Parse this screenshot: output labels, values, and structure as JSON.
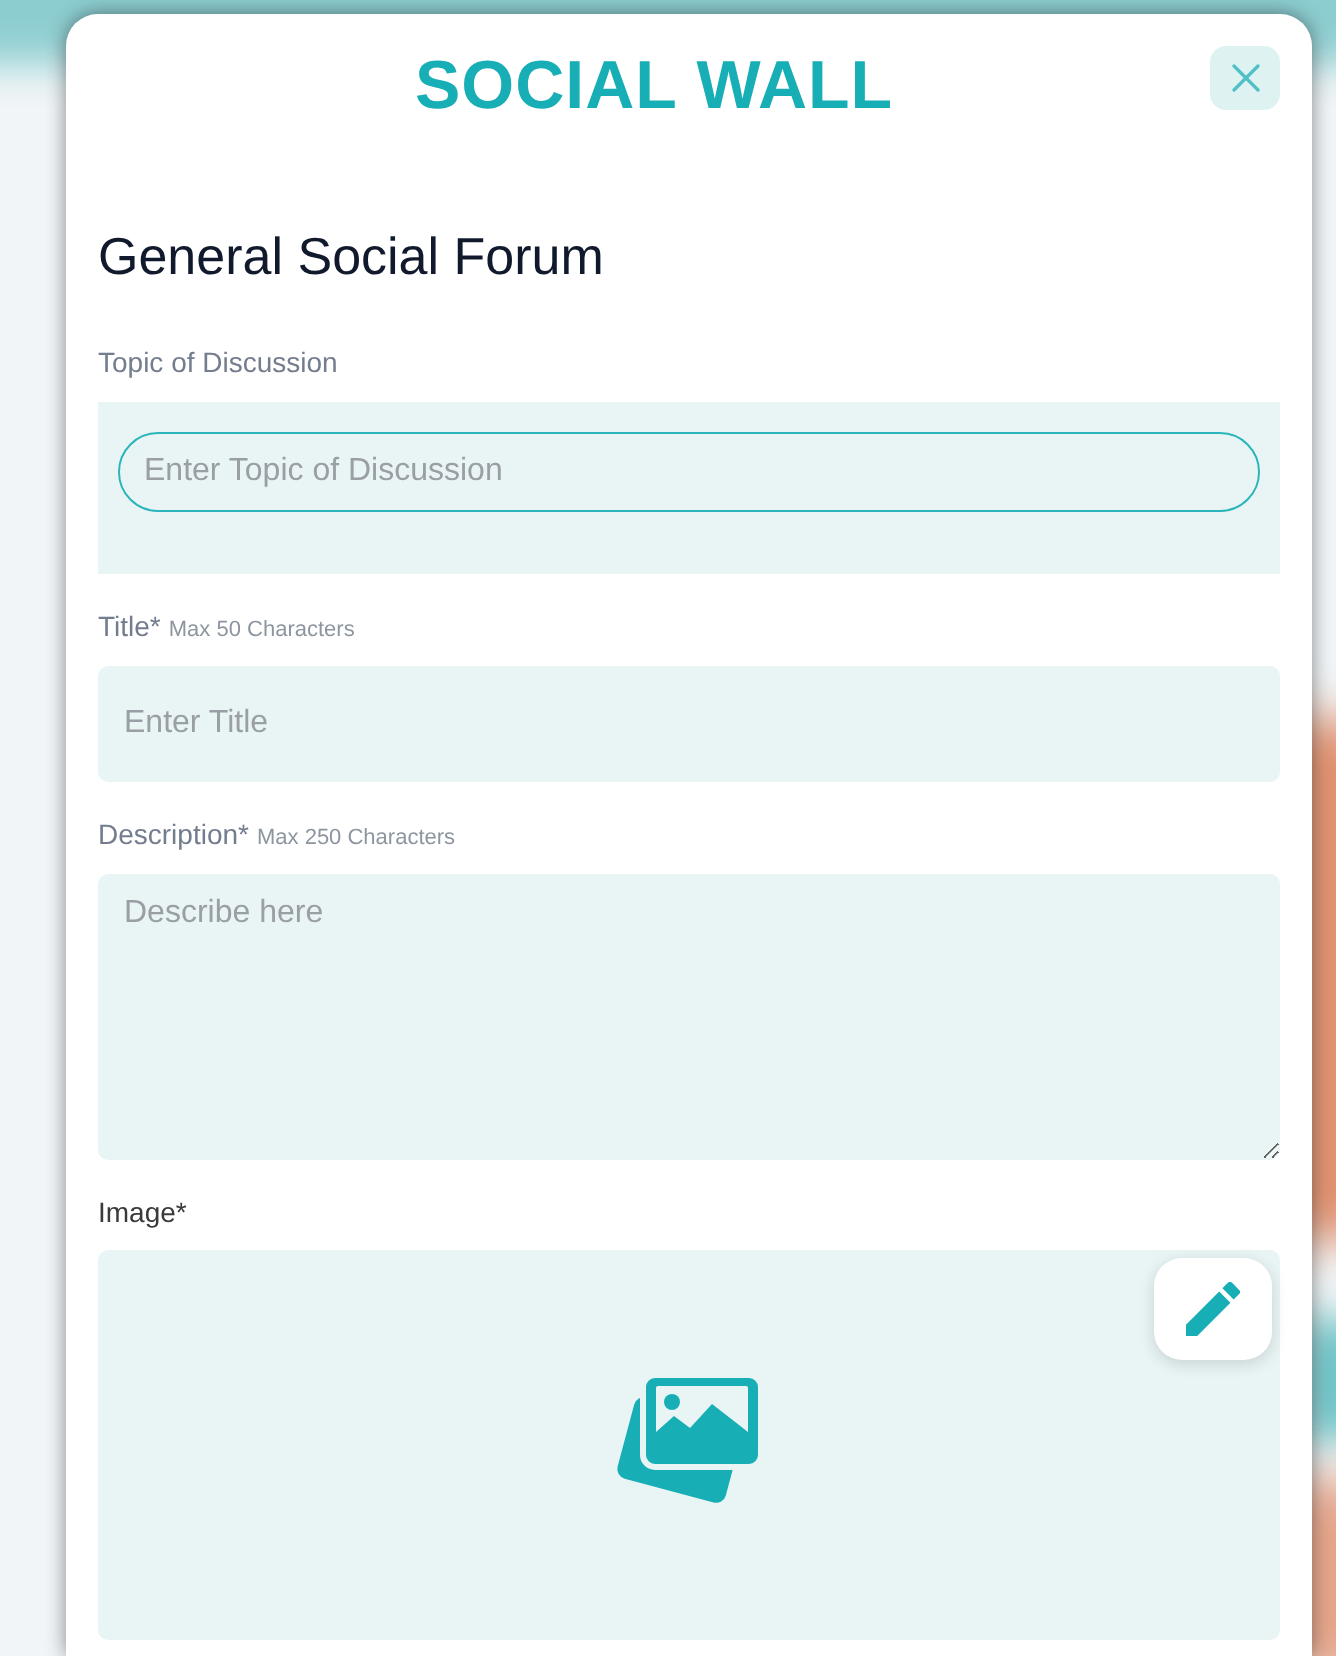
{
  "modal": {
    "title": "SOCIAL WALL",
    "heading": "General Social Forum",
    "fields": [
      {
        "kind": "pill_input",
        "label": "Topic of Discussion",
        "placeholder": "Enter Topic of Discussion"
      },
      {
        "kind": "input",
        "label": "Title*",
        "hint": "Max 50 Characters",
        "placeholder": "Enter Title"
      },
      {
        "kind": "textarea",
        "label": "Description*",
        "hint": "Max 250 Characters",
        "placeholder": "Describe here"
      },
      {
        "kind": "image",
        "label": "Image*"
      }
    ]
  }
}
